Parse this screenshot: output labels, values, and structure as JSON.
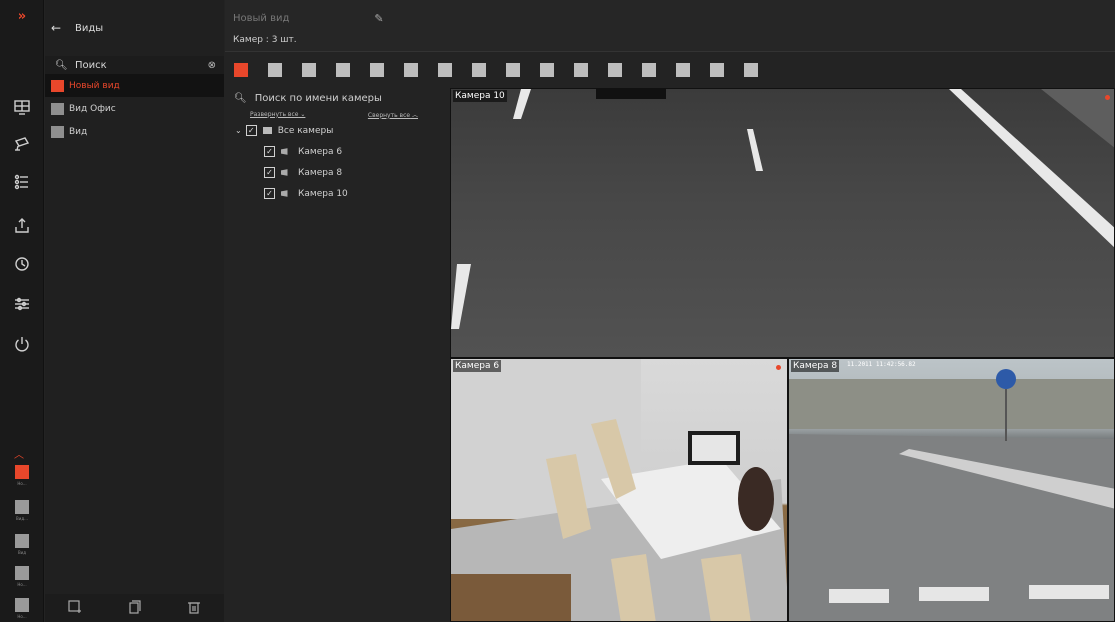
{
  "rail": {
    "toggle": "»"
  },
  "views": {
    "back_icon": "arrow-left-icon",
    "title": "Виды",
    "search_placeholder": "Поиск",
    "items": [
      {
        "label": "Новый вид",
        "active": true
      },
      {
        "label": "Вид Офис",
        "active": false
      },
      {
        "label": "Вид",
        "active": false
      }
    ]
  },
  "rail_minis": [
    {
      "label": "Но...",
      "active": true
    },
    {
      "label": "Вид...",
      "active": false
    },
    {
      "label": "Вид",
      "active": false
    },
    {
      "label": "Но...",
      "active": false
    },
    {
      "label": "Но...",
      "active": false
    }
  ],
  "header": {
    "view_name_placeholder": "Новый вид",
    "camera_count": "Камер : 3 шт."
  },
  "tree": {
    "search_placeholder": "Поиск по имени камеры",
    "expand_all": "Развернуть все",
    "collapse_all": "Свернуть все",
    "root": "Все камеры",
    "cameras": [
      "Камера 6",
      "Камера 8",
      "Камера 10"
    ]
  },
  "feeds": {
    "top": {
      "label": "Камера 10"
    },
    "bottom_left": {
      "label": "Камера 6"
    },
    "bottom_right": {
      "label": "Камера 8",
      "overlay": "11.2011 11:42:56.82"
    }
  },
  "colors": {
    "accent": "#e8472b"
  }
}
